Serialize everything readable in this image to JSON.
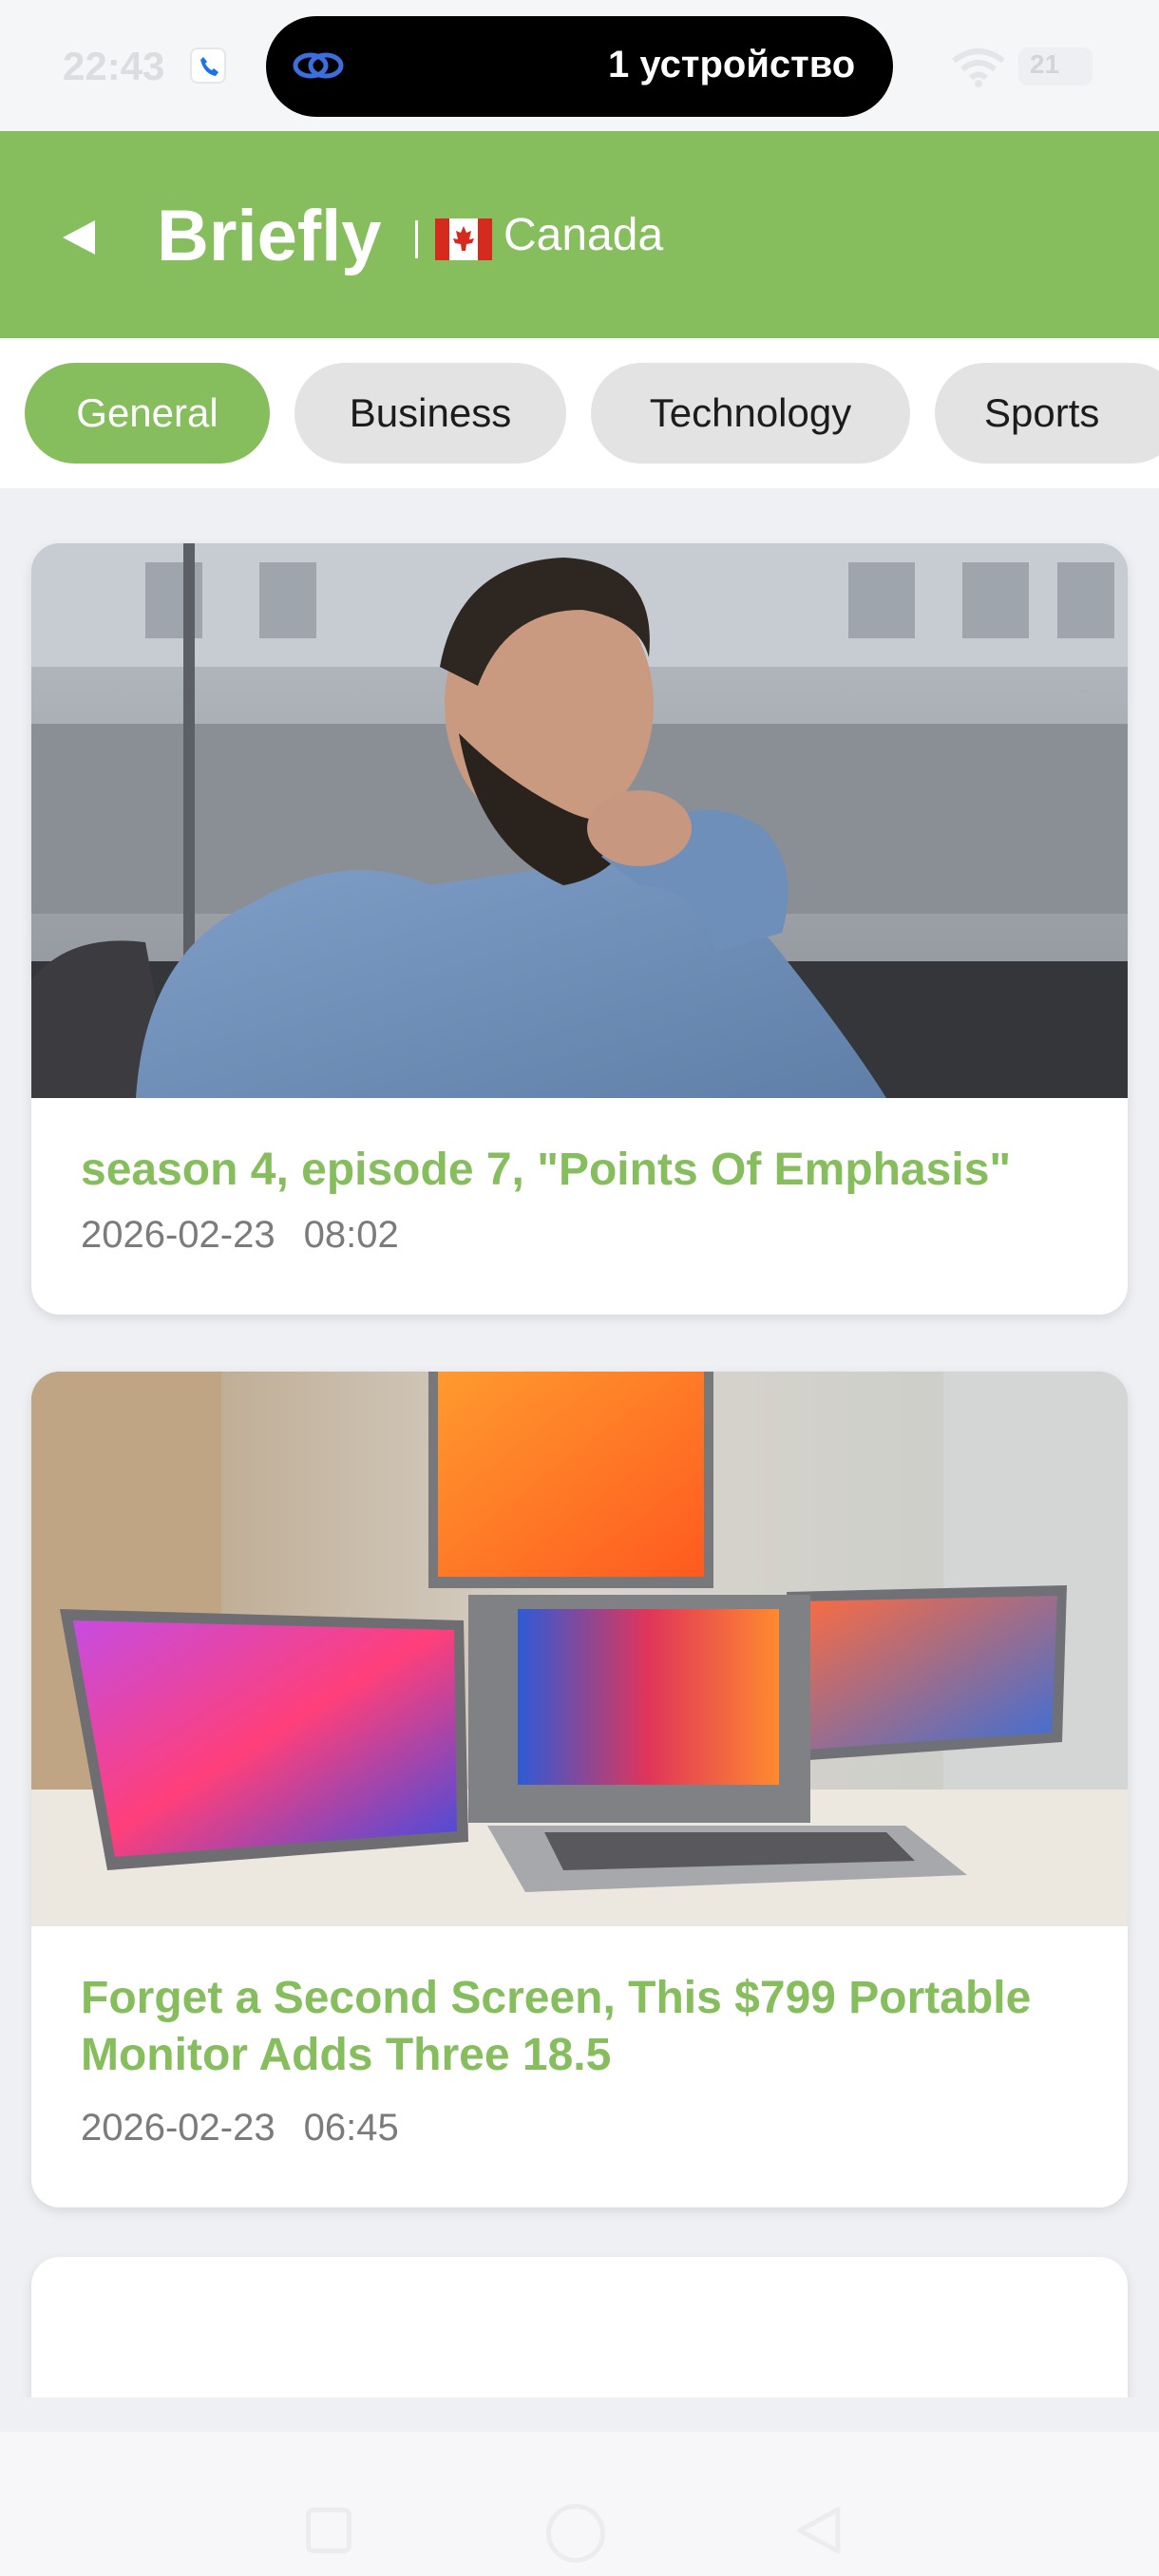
{
  "status_bar": {
    "time": "22:43",
    "island_text": "1 устройство",
    "battery_level": "21"
  },
  "header": {
    "title": "Briefly",
    "country": "Canada",
    "accent_color": "#86bd5d"
  },
  "tabs": [
    {
      "label": "General",
      "active": true
    },
    {
      "label": "Business",
      "active": false
    },
    {
      "label": "Technology",
      "active": false
    },
    {
      "label": "Sports",
      "active": false
    }
  ],
  "articles": [
    {
      "image": "man in blue shirt thinking in office",
      "title": "season 4, episode 7, \"Points Of Emphasis\"",
      "date": "2026-02-23",
      "time": "08:02"
    },
    {
      "image": "laptop with three portable monitors",
      "title": "Forget a Second Screen, This $799 Portable Monitor Adds Three 18.5",
      "date": "2026-02-23",
      "time": "06:45"
    }
  ],
  "icons": {
    "back": "back-triangle-icon",
    "flag": "canada-flag-icon",
    "nav": [
      "recents-square-icon",
      "home-circle-icon",
      "back-triangle-icon"
    ]
  }
}
